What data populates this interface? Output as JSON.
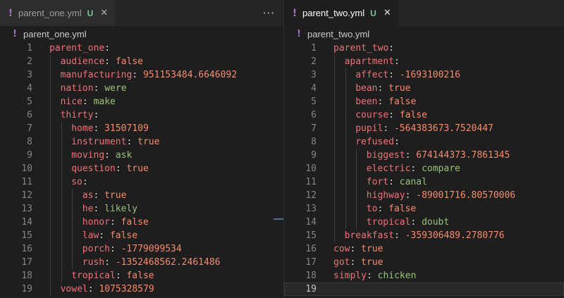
{
  "editors": [
    {
      "id": "left",
      "tab": {
        "icon": "!",
        "filename": "parent_one.yml",
        "status": "U",
        "close": "✕",
        "active": false
      },
      "more_actions": "···",
      "breadcrumb": {
        "icon": "!",
        "filename": "parent_one.yml"
      },
      "current_line": null,
      "lines": [
        {
          "n": "1",
          "indent": 0,
          "key": "parent_one",
          "value": "",
          "type": ""
        },
        {
          "n": "2",
          "indent": 1,
          "key": "audience",
          "value": "false",
          "type": "bool"
        },
        {
          "n": "3",
          "indent": 1,
          "key": "manufacturing",
          "value": "951153484.6646092",
          "type": "num"
        },
        {
          "n": "4",
          "indent": 1,
          "key": "nation",
          "value": "were",
          "type": "str"
        },
        {
          "n": "5",
          "indent": 1,
          "key": "nice",
          "value": "make",
          "type": "str"
        },
        {
          "n": "6",
          "indent": 1,
          "key": "thirty",
          "value": "",
          "type": ""
        },
        {
          "n": "7",
          "indent": 2,
          "key": "home",
          "value": "31507109",
          "type": "num"
        },
        {
          "n": "8",
          "indent": 2,
          "key": "instrument",
          "value": "true",
          "type": "bool"
        },
        {
          "n": "9",
          "indent": 2,
          "key": "moving",
          "value": "ask",
          "type": "str"
        },
        {
          "n": "10",
          "indent": 2,
          "key": "question",
          "value": "true",
          "type": "bool"
        },
        {
          "n": "11",
          "indent": 2,
          "key": "so",
          "value": "",
          "type": ""
        },
        {
          "n": "12",
          "indent": 3,
          "key": "as",
          "value": "true",
          "type": "bool"
        },
        {
          "n": "13",
          "indent": 3,
          "key": "he",
          "value": "likely",
          "type": "str"
        },
        {
          "n": "14",
          "indent": 3,
          "key": "honor",
          "value": "false",
          "type": "bool"
        },
        {
          "n": "15",
          "indent": 3,
          "key": "law",
          "value": "false",
          "type": "bool"
        },
        {
          "n": "16",
          "indent": 3,
          "key": "porch",
          "value": "-1779099534",
          "type": "num"
        },
        {
          "n": "17",
          "indent": 3,
          "key": "rush",
          "value": "-1352468562.2461486",
          "type": "num"
        },
        {
          "n": "18",
          "indent": 2,
          "key": "tropical",
          "value": "false",
          "type": "bool"
        },
        {
          "n": "19",
          "indent": 1,
          "key": "vowel",
          "value": "1075328579",
          "type": "num"
        }
      ]
    },
    {
      "id": "right",
      "tab": {
        "icon": "!",
        "filename": "parent_two.yml",
        "status": "U",
        "close": "✕",
        "active": true
      },
      "more_actions": "",
      "breadcrumb": {
        "icon": "!",
        "filename": "parent_two.yml"
      },
      "current_line": "19",
      "lines": [
        {
          "n": "1",
          "indent": 0,
          "key": "parent_two",
          "value": "",
          "type": ""
        },
        {
          "n": "2",
          "indent": 1,
          "key": "apartment",
          "value": "",
          "type": ""
        },
        {
          "n": "3",
          "indent": 2,
          "key": "affect",
          "value": "-1693100216",
          "type": "num"
        },
        {
          "n": "4",
          "indent": 2,
          "key": "bean",
          "value": "true",
          "type": "bool"
        },
        {
          "n": "5",
          "indent": 2,
          "key": "been",
          "value": "false",
          "type": "bool"
        },
        {
          "n": "6",
          "indent": 2,
          "key": "course",
          "value": "false",
          "type": "bool"
        },
        {
          "n": "7",
          "indent": 2,
          "key": "pupil",
          "value": "-564383673.7520447",
          "type": "num"
        },
        {
          "n": "8",
          "indent": 2,
          "key": "refused",
          "value": "",
          "type": ""
        },
        {
          "n": "9",
          "indent": 3,
          "key": "biggest",
          "value": "674144373.7861345",
          "type": "num"
        },
        {
          "n": "10",
          "indent": 3,
          "key": "electric",
          "value": "compare",
          "type": "str"
        },
        {
          "n": "11",
          "indent": 3,
          "key": "fort",
          "value": "canal",
          "type": "str"
        },
        {
          "n": "12",
          "indent": 3,
          "key": "highway",
          "value": "-89001716.80570006",
          "type": "num"
        },
        {
          "n": "13",
          "indent": 3,
          "key": "to",
          "value": "false",
          "type": "bool"
        },
        {
          "n": "14",
          "indent": 3,
          "key": "tropical",
          "value": "doubt",
          "type": "str"
        },
        {
          "n": "15",
          "indent": 1,
          "key": "breakfast",
          "value": "-359306489.2780776",
          "type": "num"
        },
        {
          "n": "16",
          "indent": 0,
          "key": "cow",
          "value": "true",
          "type": "bool"
        },
        {
          "n": "17",
          "indent": 0,
          "key": "got",
          "value": "true",
          "type": "bool"
        },
        {
          "n": "18",
          "indent": 0,
          "key": "simply",
          "value": "chicken",
          "type": "str"
        },
        {
          "n": "19",
          "indent": 0,
          "key": "",
          "value": "",
          "type": ""
        }
      ]
    }
  ],
  "colors": {
    "key": "#f07178",
    "number_bool": "#f78c6c",
    "string": "#98c379",
    "git_untracked": "#73c991",
    "yaml_icon": "#a074c4"
  }
}
